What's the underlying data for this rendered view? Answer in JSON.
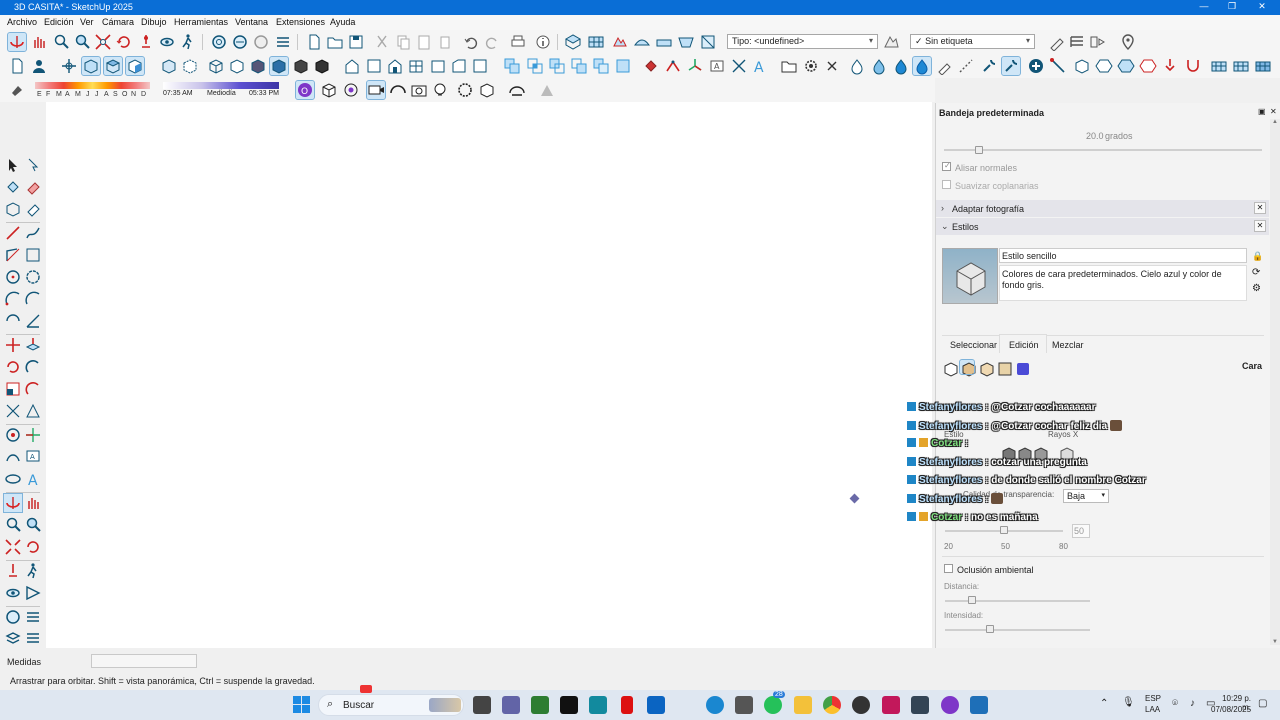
{
  "window": {
    "title": "3D CASITA* - SketchUp 2025",
    "controls": [
      "minimize",
      "maximize",
      "close"
    ]
  },
  "menu": [
    "Archivo",
    "Edición",
    "Ver",
    "Cámara",
    "Dibujo",
    "Herramientas",
    "Ventana",
    "Extensiones",
    "Ayuda"
  ],
  "toolbar": {
    "type_dropdown": "Tipo: <undefined>",
    "tag_dropdown": "Sin etiqueta",
    "tag_check": "✓"
  },
  "shadows": {
    "months": [
      "E",
      "F",
      "M",
      "A",
      "M",
      "J",
      "J",
      "A",
      "S",
      "O",
      "N",
      "D"
    ],
    "time_start": "07:35 AM",
    "time_mid": "Mediodía",
    "time_end": "05:33 PM"
  },
  "tray": {
    "title": "Bandeja predeterminada",
    "smooth": {
      "angle": "20.0",
      "angle_unit": "grados",
      "smooth_normals": "Alisar normales",
      "soften_coplanar": "Suavizar coplanarias",
      "angle_slider_level": 0.11
    },
    "sections": [
      {
        "label": "Adaptar fotografía",
        "expanded": false
      },
      {
        "label": "Estilos",
        "expanded": true
      }
    ],
    "style": {
      "name": "Estilo sencillo",
      "description": "Colores de cara predeterminados. Cielo azul y color de fondo gris."
    },
    "tabs": [
      "Seleccionar",
      "Edición",
      "Mezclar"
    ],
    "active_tab": "Edición",
    "face_label": "Cara",
    "partial_labels": {
      "estilo": "Estilo",
      "rayos_x": "Rayos X",
      "calidad_transparencia": "Calidad de transparencia:",
      "transparency_value": "Baja"
    },
    "transparency_ticks": [
      "20",
      "50",
      "80"
    ],
    "transparency_value_box": "50",
    "transparency_slider_level": 0.5,
    "ambient_occlusion": "Oclusión ambiental",
    "distance": "Distancia:",
    "intensity": "Intensidad:"
  },
  "chat": [
    {
      "user": "Stefanyflores",
      "text": ": @Cotzar cochaaaaaar",
      "emote": false,
      "role": "viewer"
    },
    {
      "user": "Stefanyflores",
      "text": ": @Cotzar cochar feliz dia",
      "emote": true,
      "role": "viewer"
    },
    {
      "user": "Cotzar",
      "text": ":",
      "emote": false,
      "role": "broadcaster"
    },
    {
      "user": "Stefanyflores",
      "text": ": cotzar una pregunta",
      "emote": false,
      "role": "viewer"
    },
    {
      "user": "Stefanyflores",
      "text": ": de donde salió el nombre Cotzar",
      "emote": false,
      "role": "viewer"
    },
    {
      "user": "Stefanyflores",
      "text": ":",
      "emote": true,
      "role": "viewer"
    },
    {
      "user": "Cotzar",
      "text": ": no es mañana",
      "emote": false,
      "role": "broadcaster"
    }
  ],
  "measurements": {
    "label": "Medidas",
    "value": ""
  },
  "status": "Arrastrar para orbitar. Shift = vista panorámica, Ctrl = suspende la gravedad.",
  "taskbar": {
    "search": "Buscar",
    "whatsapp_badge": "28",
    "language_top": "ESP",
    "language_bottom": "LAA",
    "time": "10:29 p. m.",
    "date": "07/08/2025"
  },
  "colors": {
    "titlebar": "#0a6ed6",
    "accent": "#1e88d4",
    "viewport": "#ffffff"
  }
}
